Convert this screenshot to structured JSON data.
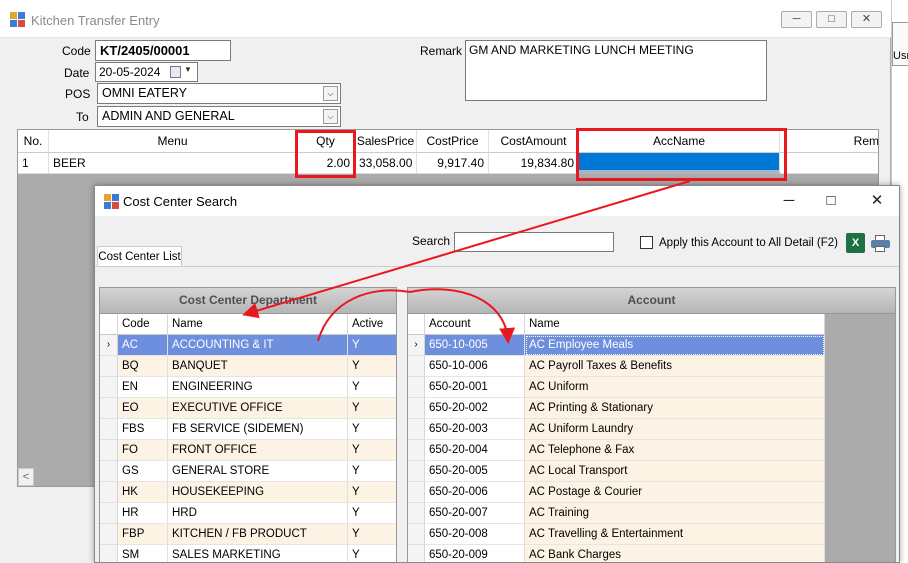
{
  "main_window": {
    "title": "Kitchen Transfer Entry",
    "controls": {
      "minimize": "─",
      "maximize": "□",
      "close": "✕"
    },
    "form": {
      "code_label": "Code",
      "code_value": "KT/2405/00001",
      "date_label": "Date",
      "date_value": "20-05-2024",
      "pos_label": "POS",
      "pos_value": "OMNI EATERY",
      "to_label": "To",
      "to_value": "ADMIN AND GENERAL",
      "remark_label": "Remark",
      "remark_value": "GM AND MARKETING LUNCH MEETING"
    },
    "grid": {
      "headers": {
        "no": "No.",
        "menu": "Menu",
        "qty": "Qty",
        "sales_price": "SalesPrice",
        "cost_price": "CostPrice",
        "cost_amount": "CostAmount",
        "acc_name": "AccName",
        "remark": "Rem"
      },
      "row": {
        "no": "1",
        "menu": "BEER",
        "qty": "2.00",
        "sales_price": "33,058.00",
        "cost_price": "9,917.40",
        "cost_amount": "19,834.80",
        "acc_name": ""
      }
    },
    "scroll_left": "<"
  },
  "behind_window_text": "Usr",
  "dialog": {
    "title": "Cost Center Search",
    "tab": "Cost Center List",
    "search_label": "Search",
    "search_value": "",
    "apply_label": "Apply this Account to All Detail (F2)",
    "department_panel": {
      "title": "Cost Center Department",
      "columns": {
        "code": "Code",
        "name": "Name",
        "active": "Active"
      },
      "rows": [
        {
          "code": "AC",
          "name": "ACCOUNTING & IT",
          "active": "Y"
        },
        {
          "code": "BQ",
          "name": "BANQUET",
          "active": "Y"
        },
        {
          "code": "EN",
          "name": "ENGINEERING",
          "active": "Y"
        },
        {
          "code": "EO",
          "name": "EXECUTIVE OFFICE",
          "active": "Y"
        },
        {
          "code": "FBS",
          "name": "FB SERVICE (SIDEMEN)",
          "active": "Y"
        },
        {
          "code": "FO",
          "name": "FRONT OFFICE",
          "active": "Y"
        },
        {
          "code": "GS",
          "name": "GENERAL STORE",
          "active": "Y"
        },
        {
          "code": "HK",
          "name": "HOUSEKEEPING",
          "active": "Y"
        },
        {
          "code": "HR",
          "name": "HRD",
          "active": "Y"
        },
        {
          "code": "FBP",
          "name": "KITCHEN / FB PRODUCT",
          "active": "Y"
        },
        {
          "code": "SM",
          "name": "SALES MARKETING",
          "active": "Y"
        }
      ]
    },
    "account_panel": {
      "title": "Account",
      "columns": {
        "account": "Account",
        "name": "Name"
      },
      "rows": [
        {
          "account": "650-10-005",
          "name": "AC Employee Meals"
        },
        {
          "account": "650-10-006",
          "name": "AC Payroll Taxes & Benefits"
        },
        {
          "account": "650-20-001",
          "name": "AC Uniform"
        },
        {
          "account": "650-20-002",
          "name": "AC Printing & Stationary"
        },
        {
          "account": "650-20-003",
          "name": "AC Uniform Laundry"
        },
        {
          "account": "650-20-004",
          "name": "AC Telephone & Fax"
        },
        {
          "account": "650-20-005",
          "name": "AC Local Transport"
        },
        {
          "account": "650-20-006",
          "name": "AC Postage & Courier"
        },
        {
          "account": "650-20-007",
          "name": "AC Training"
        },
        {
          "account": "650-20-008",
          "name": "AC Travelling & Entertainment"
        },
        {
          "account": "650-20-009",
          "name": "AC Bank Charges"
        }
      ]
    },
    "row_pointer": "›"
  },
  "colors": {
    "annotation_red": "#e8181e",
    "selection_blue": "#6e8fde",
    "accname_blue": "#0078d7",
    "alt_row": "#fdf3e4"
  },
  "icons": [
    "app-icon",
    "calendar-icon",
    "chevron-down-icon",
    "excel-icon",
    "printer-icon",
    "minimize-icon",
    "maximize-icon",
    "close-icon"
  ]
}
